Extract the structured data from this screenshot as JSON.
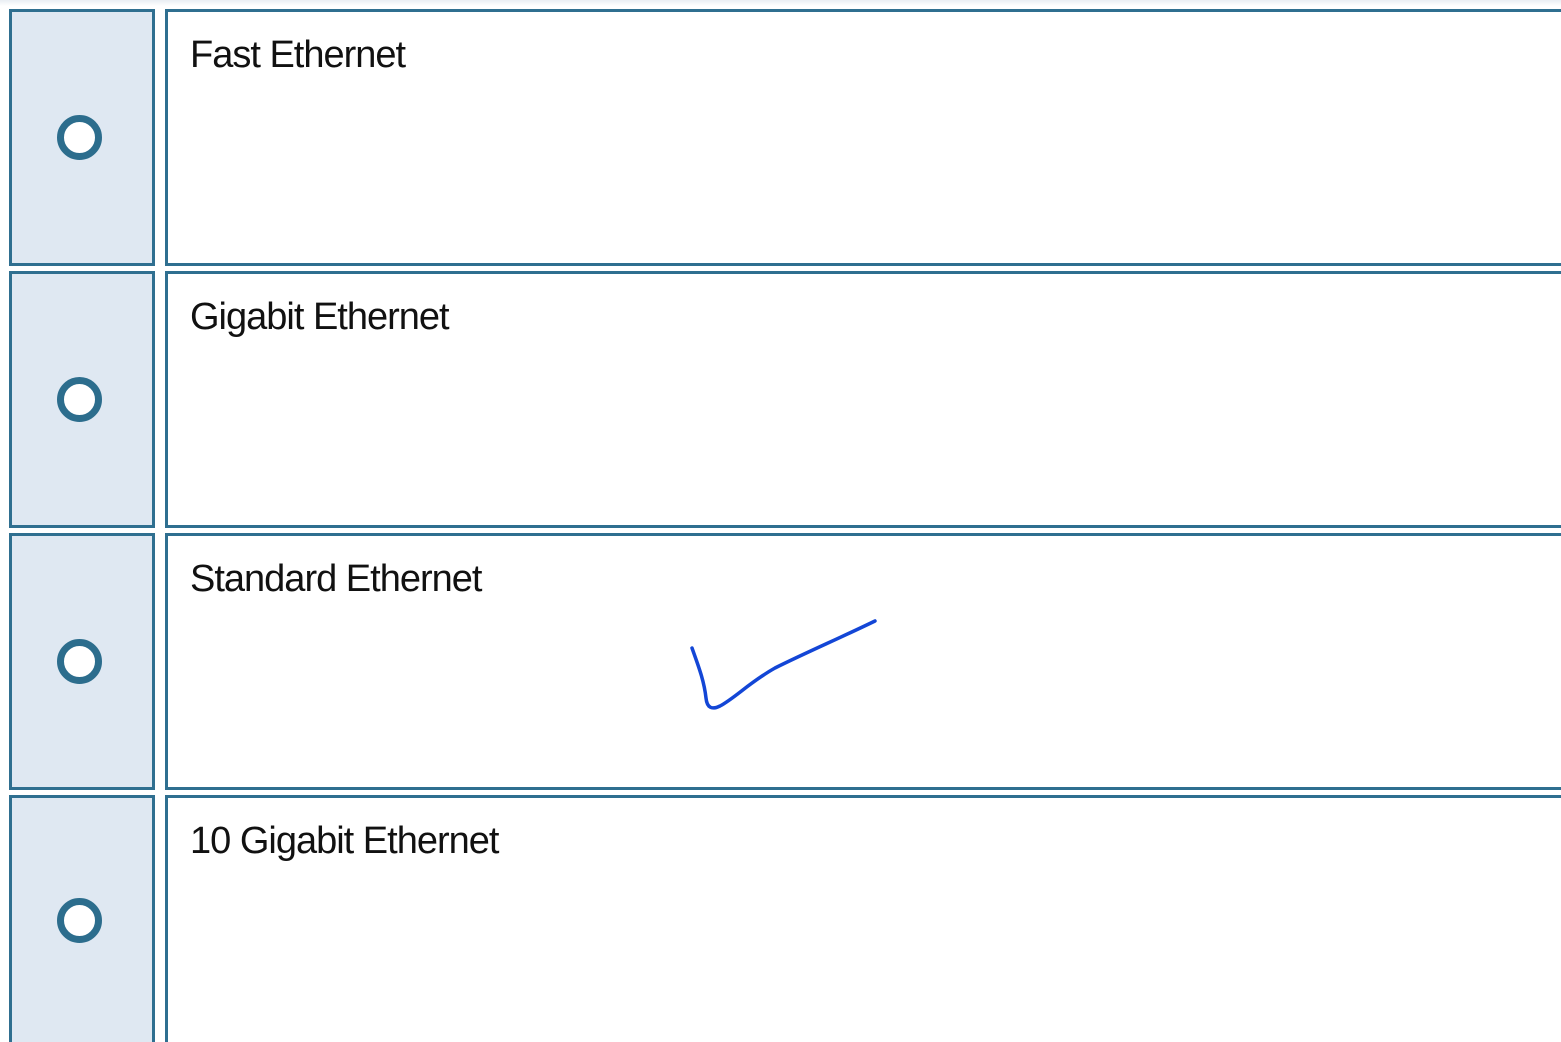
{
  "question": {
    "options": [
      {
        "label": "Fast Ethernet",
        "selected": false
      },
      {
        "label": "Gigabit Ethernet",
        "selected": false
      },
      {
        "label": "Standard Ethernet",
        "selected": false,
        "annotated_check": true
      },
      {
        "label": "10 Gigabit Ethernet",
        "selected": false
      }
    ]
  },
  "colors": {
    "border": "#2f6f90",
    "radio_cell_bg": "#dfe8f2",
    "radio_ring": "#2c6d8d",
    "checkmark": "#1346d6"
  }
}
